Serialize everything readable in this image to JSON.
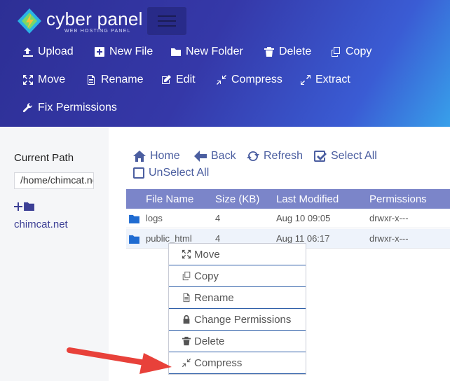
{
  "brand": {
    "name": "cyber panel",
    "subtitle": "WEB HOSTING PANEL"
  },
  "toolbar": {
    "upload": "Upload",
    "new_file": "New File",
    "new_folder": "New Folder",
    "delete": "Delete",
    "copy": "Copy",
    "move": "Move",
    "rename": "Rename",
    "edit": "Edit",
    "compress": "Compress",
    "extract": "Extract",
    "fix_permissions": "Fix Permissions"
  },
  "sidebar": {
    "current_path_label": "Current Path",
    "current_path_value": "/home/chimcat.net",
    "domain": "chimcat.net"
  },
  "nav": {
    "home": "Home",
    "back": "Back",
    "refresh": "Refresh",
    "select_all": "Select All",
    "unselect_all": "UnSelect All"
  },
  "table": {
    "headers": [
      "File Name",
      "Size (KB)",
      "Last Modified",
      "Permissions"
    ],
    "rows": [
      {
        "name": "logs",
        "size": "4",
        "modified": "Aug 10 09:05",
        "permissions": "drwxr-x---"
      },
      {
        "name": "public_html",
        "size": "4",
        "modified": "Aug 11 06:17",
        "permissions": "drwxr-x---"
      }
    ]
  },
  "context_menu": {
    "items": [
      "Move",
      "Copy",
      "Rename",
      "Change Permissions",
      "Delete",
      "Compress"
    ]
  },
  "colors": {
    "header_start": "#2d2f95",
    "header_end": "#38a0ea",
    "table_header": "#7b85c9",
    "annotation_arrow": "#e8413a"
  }
}
